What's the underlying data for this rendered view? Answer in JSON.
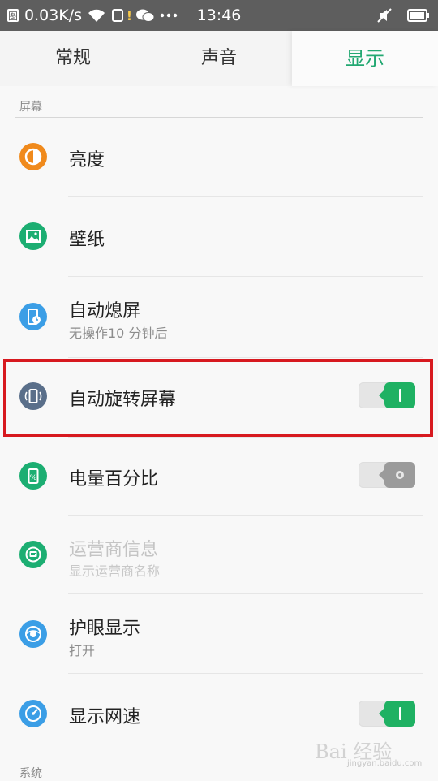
{
  "statusbar": {
    "net_speed": "0.03K/s",
    "time": "13:46",
    "icons": [
      "notification-icon",
      "wifi-icon",
      "sim-alert-icon",
      "wechat-icon",
      "more-dots-icon",
      "mute-icon",
      "battery-icon"
    ]
  },
  "tabs": [
    {
      "label": "常规",
      "active": false
    },
    {
      "label": "声音",
      "active": false
    },
    {
      "label": "显示",
      "active": true
    }
  ],
  "sections": {
    "screen": "屏幕",
    "system": "系统"
  },
  "rows": [
    {
      "title": "亮度",
      "icon": "brightness-icon",
      "color": "#f08a1c"
    },
    {
      "title": "壁纸",
      "icon": "wallpaper-icon",
      "color": "#1cae72"
    },
    {
      "title": "自动熄屏",
      "subtitle": "无操作10 分钟后",
      "icon": "screen-timeout-icon",
      "color": "#3b9ee6"
    },
    {
      "title": "自动旋转屏幕",
      "icon": "auto-rotate-icon",
      "color": "#5a6f8a",
      "toggle": "on"
    },
    {
      "title": "电量百分比",
      "icon": "battery-percent-icon",
      "color": "#1cae72",
      "toggle": "off"
    },
    {
      "title": "运营商信息",
      "subtitle": "显示运营商名称",
      "icon": "carrier-info-icon",
      "color": "#1cae72",
      "disabled": true
    },
    {
      "title": "护眼显示",
      "subtitle": "打开",
      "icon": "eye-care-icon",
      "color": "#3b9ee6"
    },
    {
      "title": "显示网速",
      "icon": "network-speed-icon",
      "color": "#3b9ee6",
      "toggle": "on"
    }
  ],
  "watermark": {
    "text": "Bai 经验",
    "url": "jingyan.baidu.com"
  },
  "colors": {
    "accent": "#23a872",
    "toggle_on": "#1fb163",
    "toggle_off": "#9b9b9b",
    "highlight": "#d7191f"
  }
}
